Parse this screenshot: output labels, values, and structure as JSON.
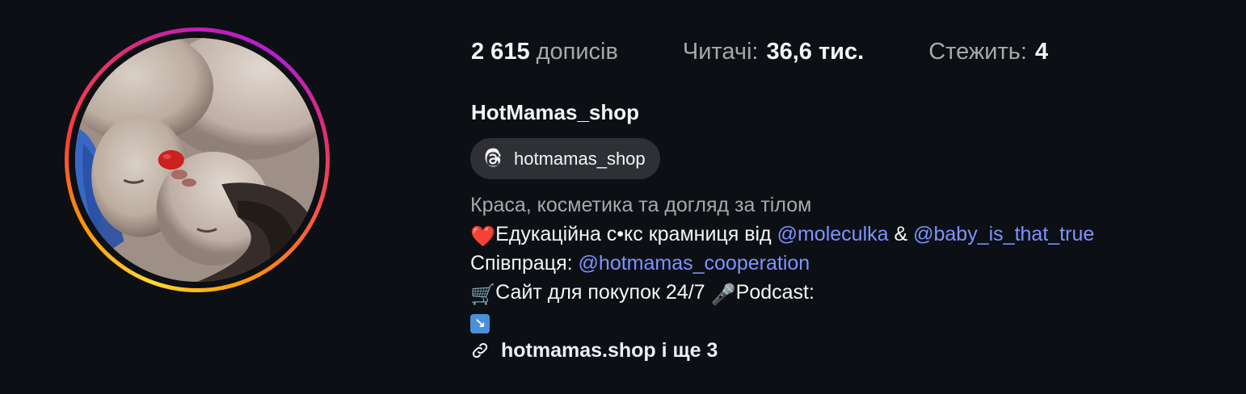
{
  "profile": {
    "username": "HotMamas_shop",
    "stats": {
      "posts_count": "2 615",
      "posts_label": "дописів",
      "followers_label": "Читачі:",
      "followers_count": "36,6 тис.",
      "following_label": "Стежить:",
      "following_count": "4"
    },
    "threads_handle": "hotmamas_shop",
    "category": "Краса, косметика та догляд за тілом",
    "bio": {
      "line1_emoji": "❤️",
      "line1_text": "Едукаційна с•кс крамниця від",
      "mention1": "@moleculka",
      "amp": "&",
      "mention2": "@baby_is_that_true",
      "line2_prefix": "Співпраця:",
      "mention3": "@hotmamas_cooperation",
      "line3_cart": "🛒",
      "line3_text": "Сайт для покупок 24/7",
      "line3_mic": "🎤",
      "line3_tail": "Podcast:",
      "line4_arrow": "↘"
    },
    "link_text": "hotmamas.shop і ще 3"
  },
  "colors": {
    "background": "#0c0f14",
    "mention": "#7e93ff",
    "muted": "#a8a8a8",
    "chip": "#2e3035"
  },
  "icons": {
    "threads": "threads-icon",
    "link": "link-icon"
  }
}
